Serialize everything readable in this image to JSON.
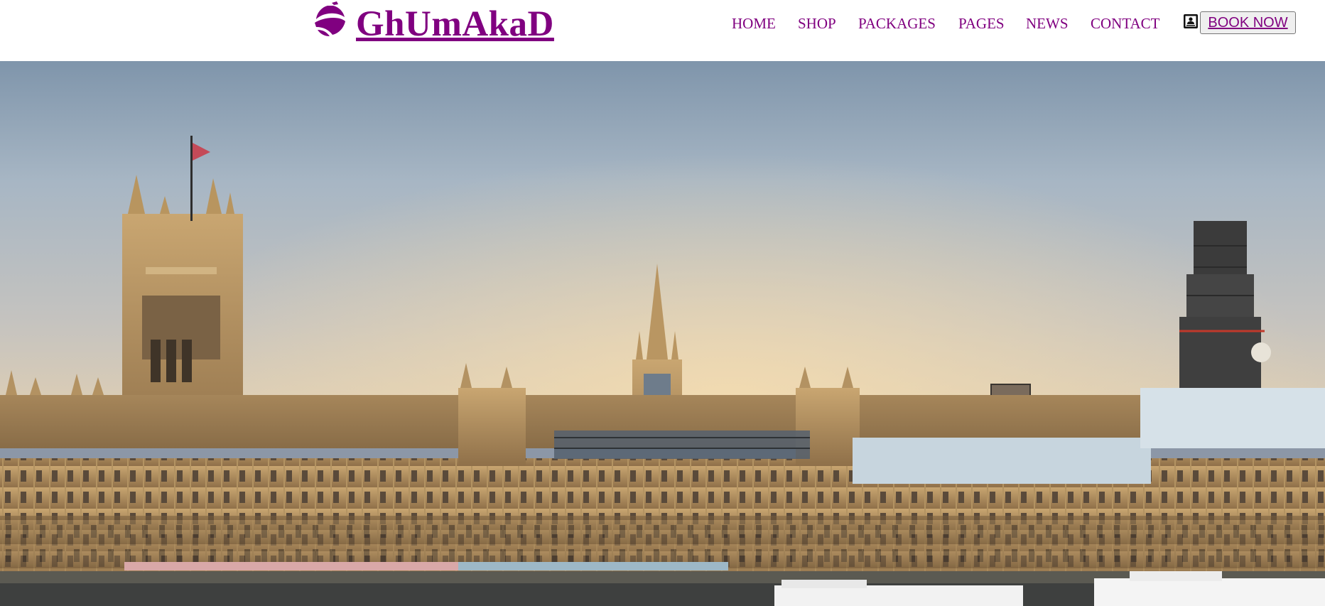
{
  "brand": {
    "name": "GhUmAkaD",
    "logo_icon": "globe-plane-icon",
    "color": "#800080"
  },
  "nav": {
    "items": [
      {
        "label": "HOME"
      },
      {
        "label": "SHOP"
      },
      {
        "label": "PACKAGES"
      },
      {
        "label": "PAGES"
      },
      {
        "label": "NEWS"
      },
      {
        "label": "CONTACT"
      }
    ],
    "book_icon": "contact-card-icon",
    "book_label": "BOOK NOW"
  },
  "hero": {
    "image": "palace-of-westminster-photo"
  }
}
